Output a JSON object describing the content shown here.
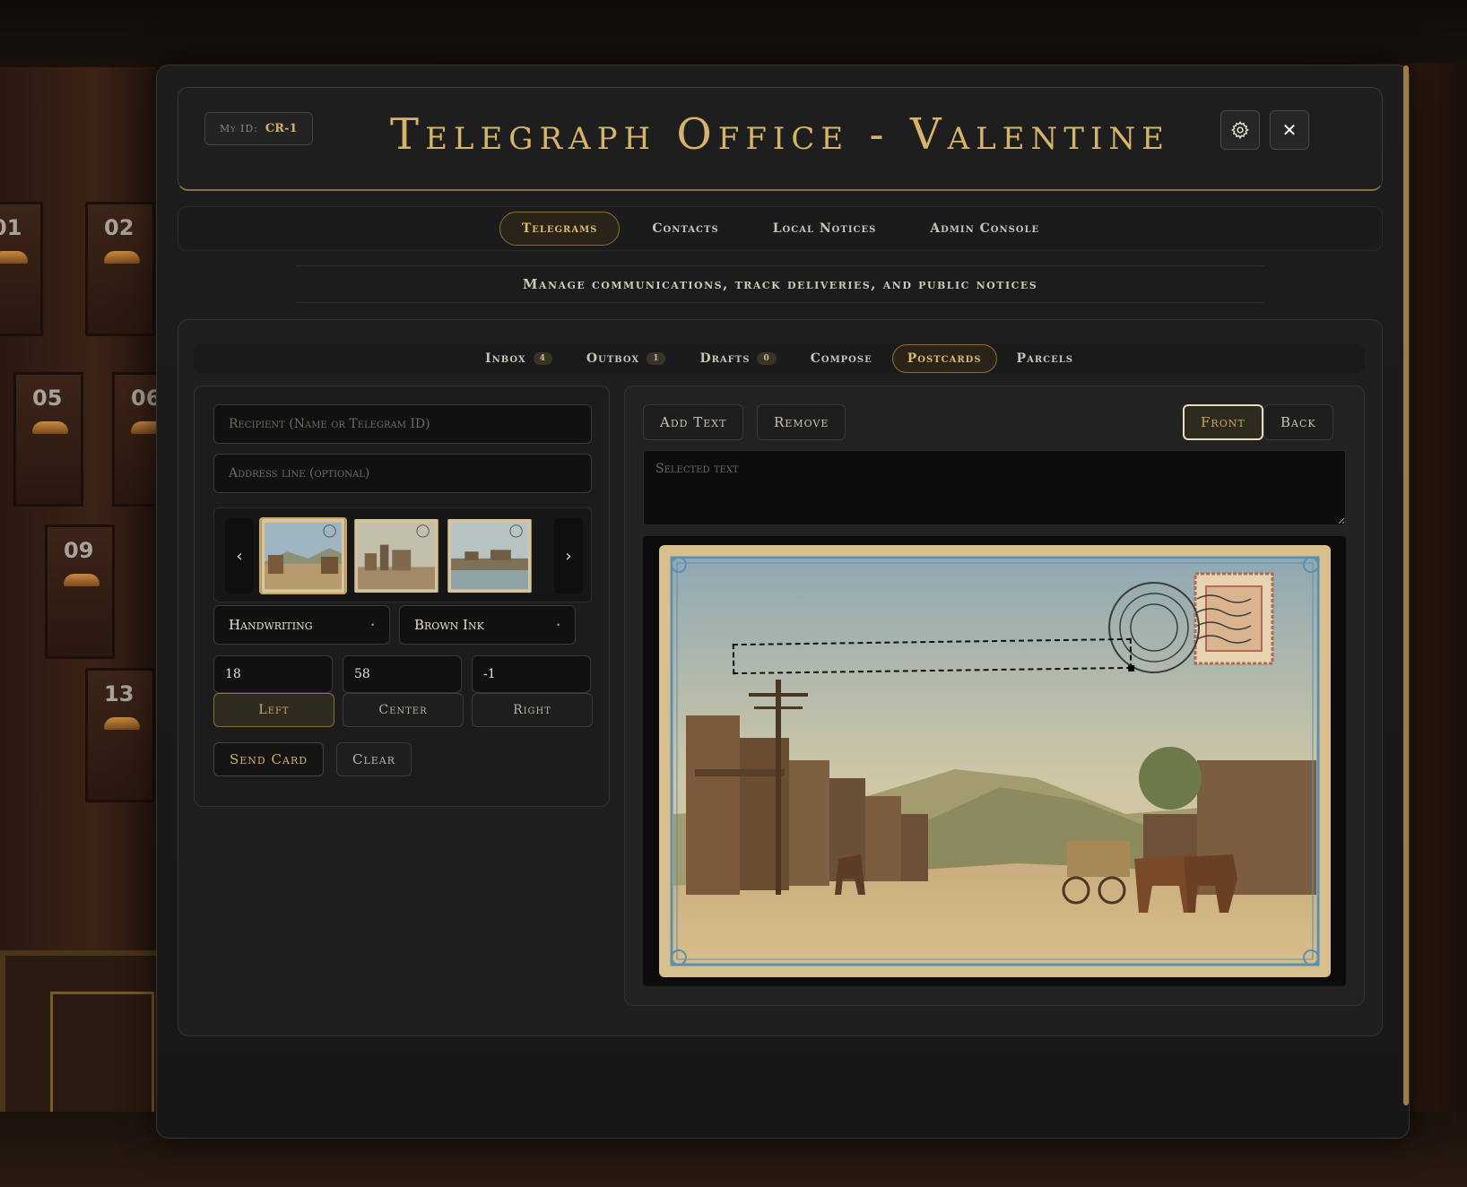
{
  "header": {
    "my_id_label": "My ID:",
    "my_id_value": "CR-1",
    "title": "Telegraph Office - Valentine"
  },
  "nav": {
    "tabs": [
      {
        "label": "Telegrams",
        "active": true
      },
      {
        "label": "Contacts",
        "active": false
      },
      {
        "label": "Local Notices",
        "active": false
      },
      {
        "label": "Admin Console",
        "active": false
      }
    ]
  },
  "subtitle": "Manage communications, track deliveries, and public notices",
  "subtabs": [
    {
      "label": "Inbox",
      "badge": "4"
    },
    {
      "label": "Outbox",
      "badge": "1"
    },
    {
      "label": "Drafts",
      "badge": "0"
    },
    {
      "label": "Compose",
      "badge": ""
    },
    {
      "label": "Postcards",
      "badge": "",
      "active": true
    },
    {
      "label": "Parcels",
      "badge": ""
    }
  ],
  "form": {
    "recipient_placeholder": "Recipient (Name or Telegram ID)",
    "address_placeholder": "Address line (optional)",
    "font_select": "Handwriting",
    "ink_select": "Brown Ink",
    "size_value": "18",
    "x_value": "58",
    "y_value": "-1",
    "align_left": "Left",
    "align_center": "Center",
    "align_right": "Right",
    "send_label": "Send Card",
    "clear_label": "Clear",
    "prev_glyph": "‹",
    "next_glyph": "›"
  },
  "editor": {
    "add_text_label": "Add Text",
    "remove_label": "Remove",
    "front_label": "Front",
    "back_label": "Back",
    "selected_text_placeholder": "Selected text"
  },
  "colors": {
    "accent_gold": "#d8b46a",
    "panel_bg": "#1f1f1f"
  }
}
